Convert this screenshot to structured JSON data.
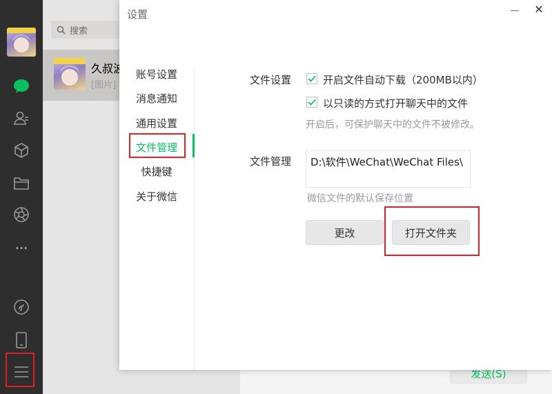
{
  "rail": {
    "icons": [
      "avatar",
      "chat-icon",
      "contacts-icon",
      "cube-icon",
      "folder-icon",
      "moments-icon",
      "more-icon",
      "miniprogram-icon",
      "phone-icon",
      "menu-icon"
    ],
    "more_label": "···"
  },
  "chatlist": {
    "search_placeholder": "搜索",
    "item": {
      "name": "久叔波",
      "preview": "[图片]"
    }
  },
  "chatpane": {
    "send_label": "发送(S)"
  },
  "dialog": {
    "title": "设置",
    "close_glyph": "✕",
    "nav": [
      {
        "label": "账号设置",
        "active": false
      },
      {
        "label": "消息通知",
        "active": false
      },
      {
        "label": "通用设置",
        "active": false
      },
      {
        "label": "文件管理",
        "active": true
      },
      {
        "label": "快捷键",
        "active": false
      },
      {
        "label": "关于微信",
        "active": false
      }
    ],
    "file_settings": {
      "label": "文件设置",
      "auto_download": {
        "text": "开启文件自动下载（200MB以内）",
        "checked": true
      },
      "read_only": {
        "text": "以只读的方式打开聊天中的文件",
        "checked": true
      },
      "hint": "开启后，可保护聊天中的文件不被修改。"
    },
    "file_management": {
      "label": "文件管理",
      "path": "D:\\软件\\WeChat\\WeChat Files\\",
      "hint": "微信文件的默认保存位置",
      "change_button": "更改",
      "open_folder_button": "打开文件夹"
    }
  },
  "colors": {
    "accent": "#07c160",
    "highlight": "#e02020",
    "rail": "#2e2e2e"
  }
}
